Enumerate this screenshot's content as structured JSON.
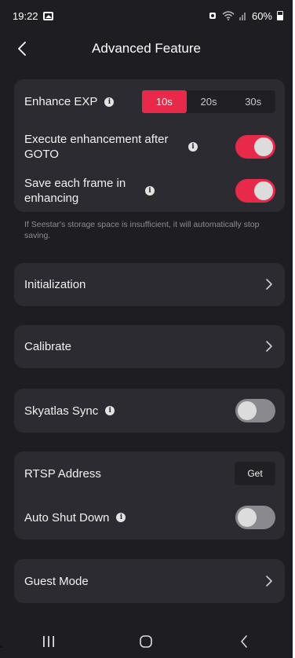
{
  "status_bar": {
    "time": "19:22",
    "battery": "60%",
    "icons": [
      "gallery-icon",
      "alarm-icon",
      "wifi-icon",
      "signal-icon",
      "battery-icon"
    ]
  },
  "header": {
    "title": "Advanced Feature",
    "back_icon": "chevron-left-icon"
  },
  "enhance_card": {
    "exp_label": "Enhance EXP",
    "exp_options": [
      "10s",
      "20s",
      "30s"
    ],
    "exp_selected": "10s",
    "execute_label": "Execute enhancement after GOTO",
    "execute_on": true,
    "save_frame_label": "Save each frame in enhancing",
    "save_frame_on": true
  },
  "storage_note": "If Seestar's storage space is insufficient, it will automatically stop saving.",
  "initialization_label": "Initialization",
  "calibrate_label": "Calibrate",
  "skyatlas_label": "Skyatlas Sync",
  "skyatlas_on": false,
  "rtsp_label": "RTSP Address",
  "rtsp_button": "Get",
  "auto_shutdown_label": "Auto Shut Down",
  "auto_shutdown_on": false,
  "guest_mode_label": "Guest Mode",
  "nav_bar": {
    "icons": [
      "recent-apps-icon",
      "home-icon",
      "back-icon"
    ]
  },
  "colors": {
    "background": "#1d1d22",
    "card": "#2b2b31",
    "accent": "#e8294a",
    "toggle_off": "#8a8a8e"
  }
}
